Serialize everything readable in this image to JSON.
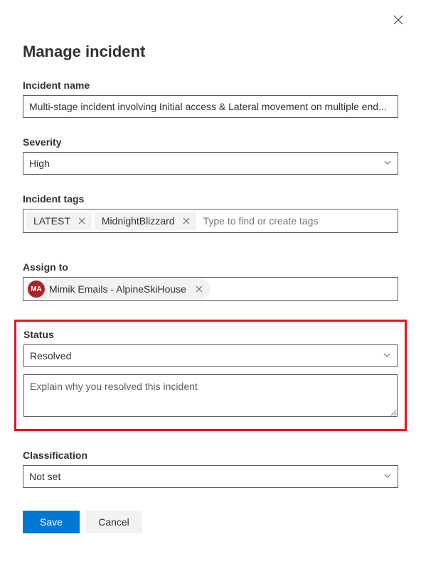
{
  "header": {
    "title": "Manage incident"
  },
  "fields": {
    "incident_name": {
      "label": "Incident name",
      "value": "Multi-stage incident involving Initial access & Lateral movement on multiple end..."
    },
    "severity": {
      "label": "Severity",
      "value": "High"
    },
    "tags": {
      "label": "Incident tags",
      "items": [
        "LATEST",
        "MidnightBlizzard"
      ],
      "placeholder": "Type to find or create tags"
    },
    "assign_to": {
      "label": "Assign to",
      "assignee": {
        "initials": "MA",
        "name": "Mimik Emails - AlpineSkiHouse"
      }
    },
    "status": {
      "label": "Status",
      "value": "Resolved",
      "explain_placeholder": "Explain why you resolved this incident"
    },
    "classification": {
      "label": "Classification",
      "value": "Not set"
    }
  },
  "footer": {
    "save": "Save",
    "cancel": "Cancel"
  }
}
